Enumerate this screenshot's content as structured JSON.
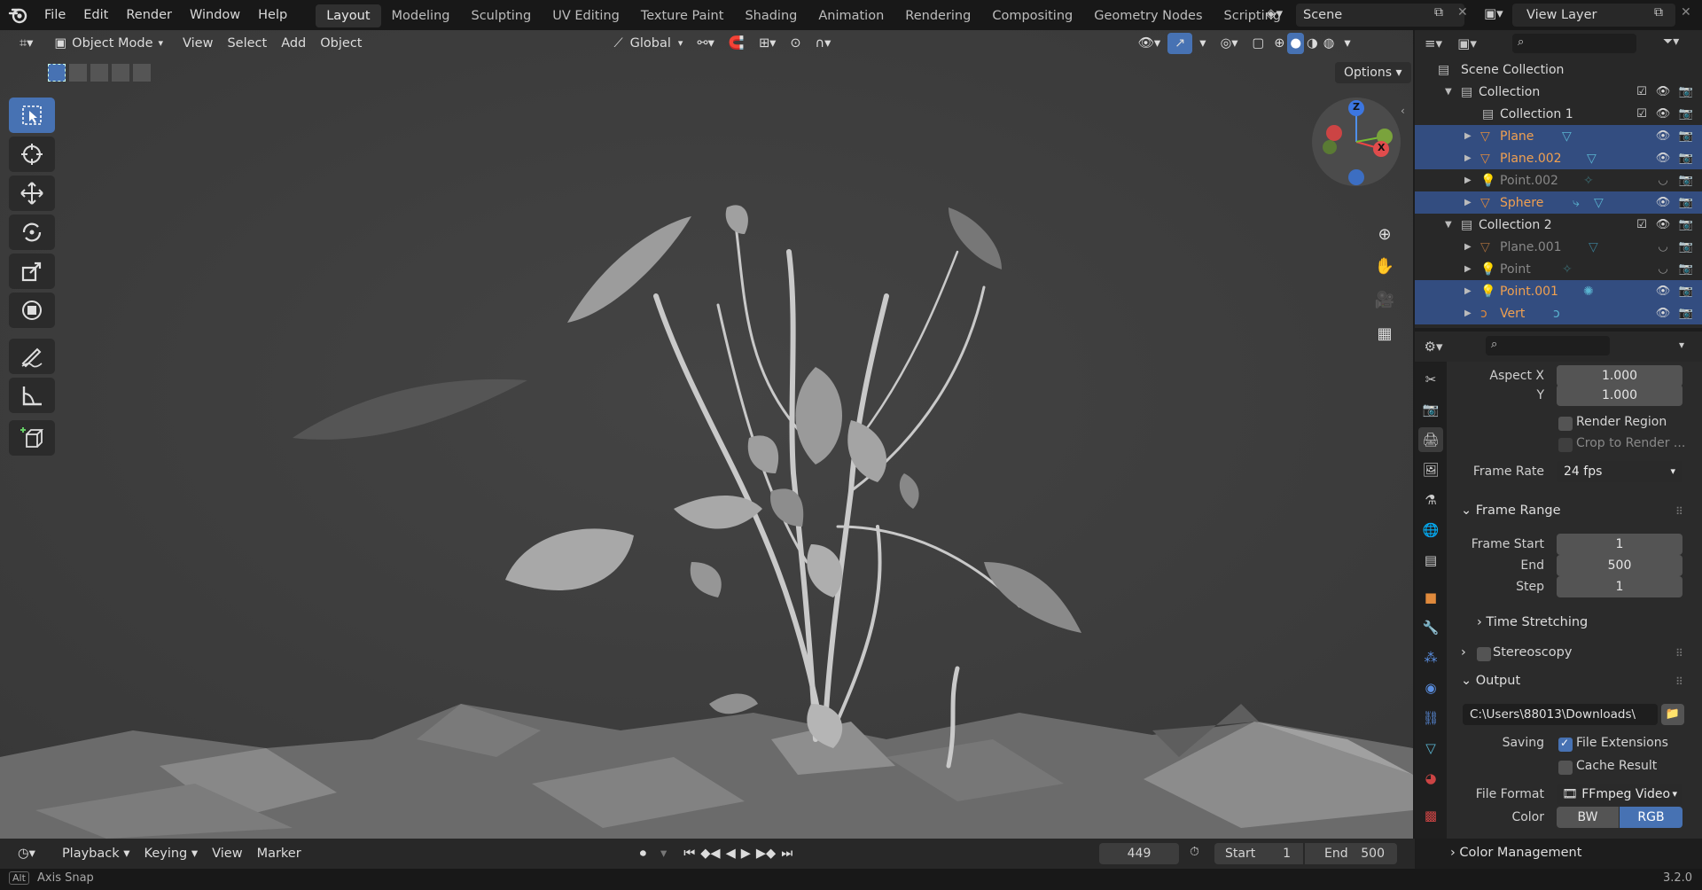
{
  "topbar": {
    "menus": [
      "File",
      "Edit",
      "Render",
      "Window",
      "Help"
    ],
    "workspaces": [
      "Layout",
      "Modeling",
      "Sculpting",
      "UV Editing",
      "Texture Paint",
      "Shading",
      "Animation",
      "Rendering",
      "Compositing",
      "Geometry Nodes",
      "Scripting"
    ],
    "active_workspace": "Layout",
    "scene": "Scene",
    "view_layer": "View Layer"
  },
  "viewport": {
    "mode": "Object Mode",
    "menus": [
      "View",
      "Select",
      "Add",
      "Object"
    ],
    "orientation": "Global",
    "options_label": "Options",
    "gizmo_axes": {
      "z": "Z",
      "x": "X"
    }
  },
  "outliner": {
    "root": "Scene Collection",
    "rows": [
      {
        "name": "Collection",
        "type": "collection"
      },
      {
        "name": "Collection 1",
        "type": "collection"
      },
      {
        "name": "Plane",
        "type": "mesh",
        "selected": true
      },
      {
        "name": "Plane.002",
        "type": "mesh",
        "selected": true
      },
      {
        "name": "Point.002",
        "type": "light",
        "selected": false
      },
      {
        "name": "Sphere",
        "type": "mesh",
        "selected": true
      },
      {
        "name": "Collection 2",
        "type": "collection"
      },
      {
        "name": "Plane.001",
        "type": "mesh",
        "selected": false
      },
      {
        "name": "Point",
        "type": "light",
        "selected": false
      },
      {
        "name": "Point.001",
        "type": "light",
        "selected": true
      },
      {
        "name": "Vert",
        "type": "curve",
        "selected": true
      }
    ]
  },
  "properties": {
    "aspect_x_label": "Aspect X",
    "aspect_x": "1.000",
    "aspect_y_label": "Y",
    "aspect_y": "1.000",
    "render_region": "Render Region",
    "crop_to_render": "Crop to Render ...",
    "frame_rate_label": "Frame Rate",
    "frame_rate": "24 fps",
    "frame_range_title": "Frame Range",
    "frame_start_label": "Frame Start",
    "frame_start": "1",
    "end_label": "End",
    "end": "500",
    "step_label": "Step",
    "step": "1",
    "time_stretching": "Time Stretching",
    "stereoscopy": "Stereoscopy",
    "output_title": "Output",
    "output_path": "C:\\Users\\88013\\Downloads\\",
    "saving_label": "Saving",
    "file_extensions": "File Extensions",
    "cache_result": "Cache Result",
    "file_format_label": "File Format",
    "file_format": "FFmpeg Video",
    "color_label": "Color",
    "color_bw": "BW",
    "color_rgb": "RGB",
    "color_management": "Color Management"
  },
  "timeline": {
    "menus": [
      "Playback",
      "Keying",
      "View",
      "Marker"
    ],
    "current_frame": "449",
    "start_label": "Start",
    "start": "1",
    "end_label": "End",
    "end": "500"
  },
  "status": {
    "key": "Alt",
    "hint": "Axis Snap",
    "version": "3.2.0"
  }
}
